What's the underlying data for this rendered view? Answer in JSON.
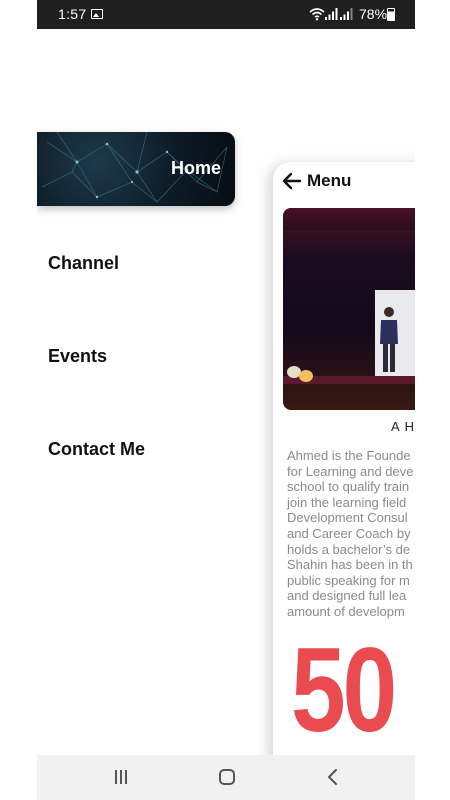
{
  "status_bar": {
    "time": "1:57",
    "battery_percent": "78%",
    "icons": [
      "image-icon",
      "wifi-icon",
      "signal-icon",
      "signal-icon",
      "battery-icon"
    ]
  },
  "drawer": {
    "home_label": "Home",
    "items": [
      {
        "label": "Channel"
      },
      {
        "label": "Events"
      },
      {
        "label": "Contact Me"
      }
    ]
  },
  "content": {
    "title": "Menu",
    "caption": "A H",
    "bio_lines": [
      "Ahmed is the Founde",
      "for Learning and deve",
      "school to qualify train",
      "join the learning field",
      "Development Consul",
      "and Career Coach by",
      "holds a bachelor’s de",
      "Shahin has been in th",
      "public speaking for m",
      "and designed full lea",
      "amount of developm"
    ],
    "big_number": "50"
  },
  "colors": {
    "accent_red": "#ea4b4f",
    "status_bar": "#1f1f1f",
    "nav_bar": "#f1f1f1",
    "bio_text": "#8a8a8a"
  }
}
